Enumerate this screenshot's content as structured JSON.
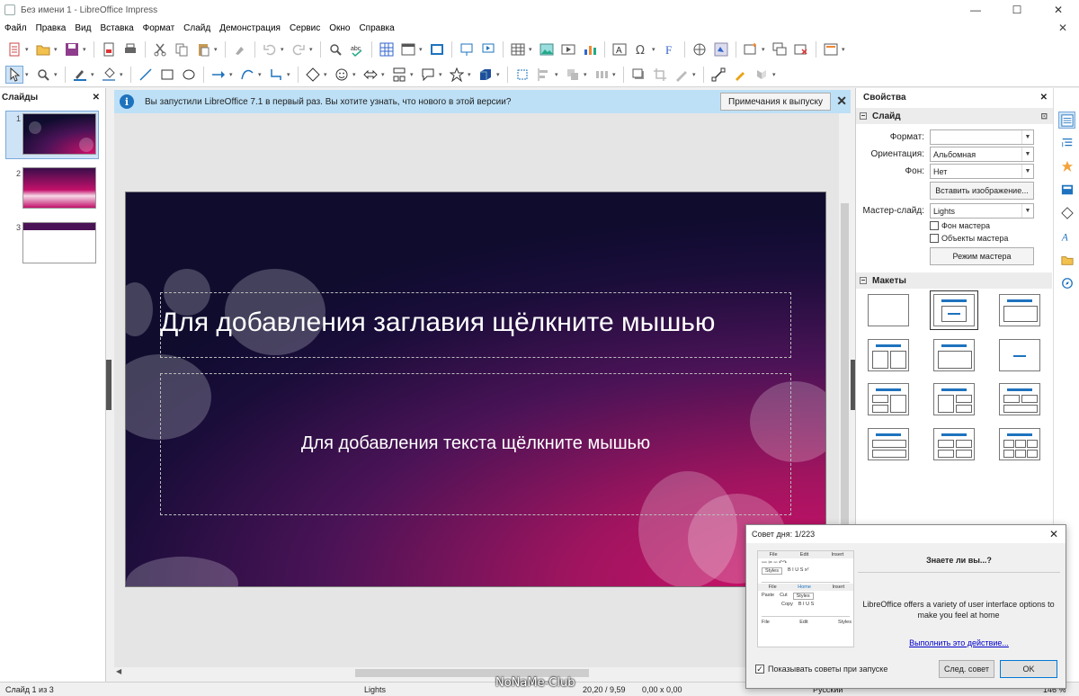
{
  "window": {
    "title": "Без имени 1 - LibreOffice Impress",
    "minimize": "—",
    "maximize": "☐",
    "close": "✕"
  },
  "menu": [
    "Файл",
    "Правка",
    "Вид",
    "Вставка",
    "Формат",
    "Слайд",
    "Демонстрация",
    "Сервис",
    "Окно",
    "Справка"
  ],
  "slides_pane": {
    "title": "Слайды",
    "close": "✕",
    "thumbs": [
      "1",
      "2",
      "3"
    ]
  },
  "infobar": {
    "text": "Вы запустили LibreOffice 7.1 в первый раз. Вы хотите узнать, что нового в этой версии?",
    "button": "Примечания к выпуску",
    "close": "✕"
  },
  "slide": {
    "title_placeholder": "Для добавления заглавия щёлкните мышью",
    "body_placeholder": "Для добавления текста щёлкните мышью"
  },
  "sidebar": {
    "title": "Свойства",
    "close": "✕",
    "section_slide": "Слайд",
    "format_label": "Формат:",
    "format_value": "",
    "orientation_label": "Ориентация:",
    "orientation_value": "Альбомная",
    "background_label": "Фон:",
    "background_value": "Нет",
    "insert_image": "Вставить изображение...",
    "master_label": "Мастер-слайд:",
    "master_value": "Lights",
    "master_bg": "Фон мастера",
    "master_objects": "Объекты мастера",
    "master_mode": "Режим мастера",
    "section_layouts": "Макеты"
  },
  "status": {
    "slide": "Слайд 1 из 3",
    "master": "Lights",
    "position": "20,20 / 9,59",
    "size": "0,00 x 0,00",
    "language": "Русский",
    "zoom": "146 %"
  },
  "dialog": {
    "title": "Совет дня: 1/223",
    "close": "✕",
    "heading": "Знаете ли вы...?",
    "text": "LibreOffice offers a variety of user interface options to make you feel at home",
    "link": "Выполнить это действие...",
    "checkbox": "Показывать советы при запуске",
    "next": "След. совет",
    "ok": "OK",
    "mini": {
      "tabs1": [
        "File",
        "Edit",
        "Insert"
      ],
      "styles": "Styles",
      "tabs2": [
        "File",
        "Home",
        "Insert"
      ],
      "cut": "Cut",
      "copy": "Copy",
      "paste": "Paste",
      "styles2": "Styles",
      "file": "File",
      "edit": "Edit",
      "styles3": "Styles"
    }
  },
  "watermark": "NoNaMe-Club"
}
